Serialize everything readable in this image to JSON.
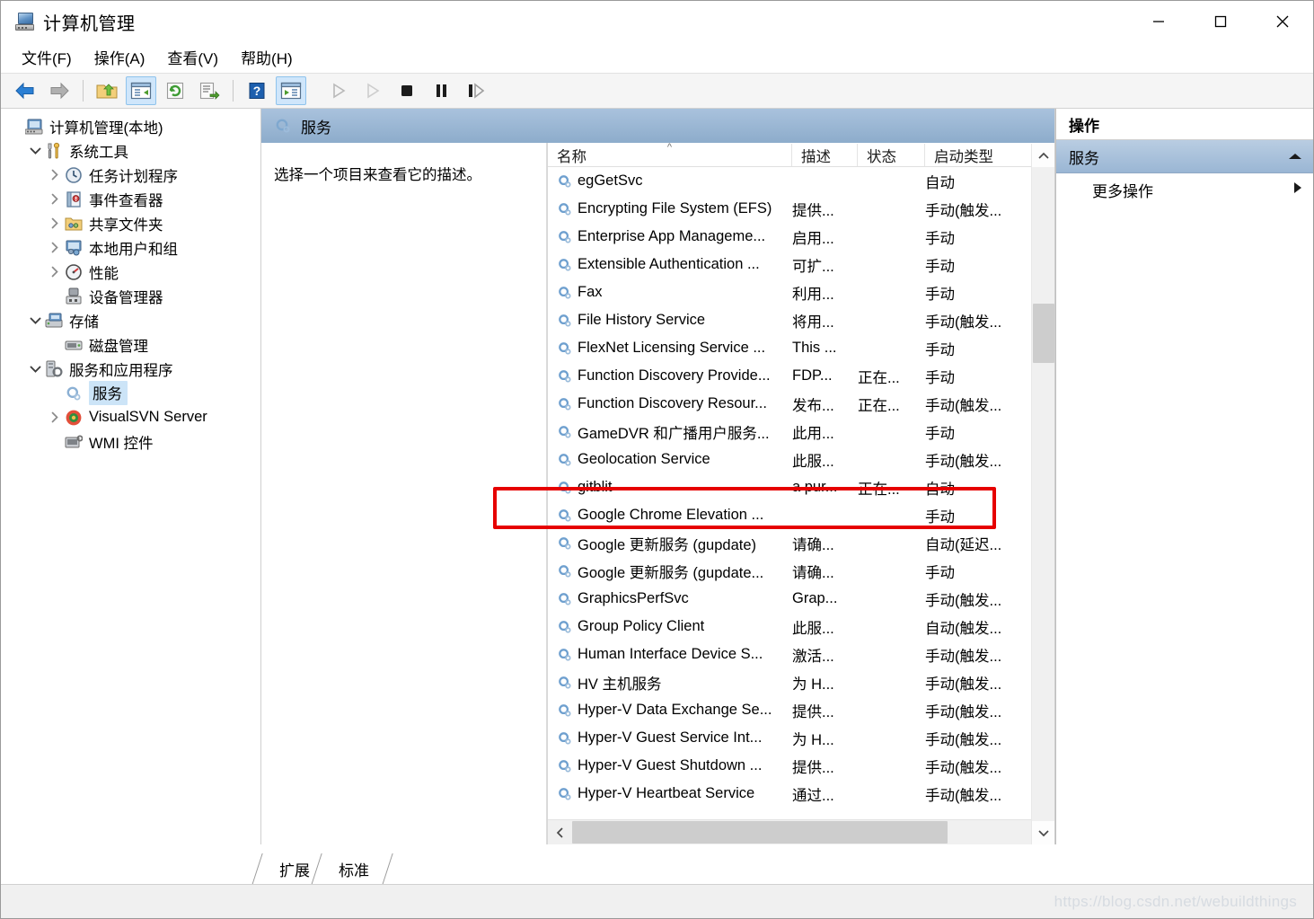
{
  "window": {
    "title": "计算机管理",
    "icon": "computer-management-icon",
    "controls": {
      "minimize": "最小化",
      "maximize": "最大化",
      "close": "关闭"
    }
  },
  "menubar": {
    "items": [
      {
        "name": "file",
        "label": "文件(F)"
      },
      {
        "name": "action",
        "label": "操作(A)"
      },
      {
        "name": "view",
        "label": "查看(V)"
      },
      {
        "name": "help",
        "label": "帮助(H)"
      }
    ]
  },
  "toolbar": {
    "buttons": [
      {
        "name": "back-button",
        "icon": "back-arrow-icon",
        "state": "enabled"
      },
      {
        "name": "forward-button",
        "icon": "forward-arrow-icon",
        "state": "disabled"
      },
      {
        "name": "up-one-level-button",
        "icon": "folder-up-icon",
        "state": "enabled"
      },
      {
        "name": "show-hide-tree-button",
        "icon": "console-tree-icon",
        "state": "active"
      },
      {
        "name": "refresh-button",
        "icon": "refresh-icon",
        "state": "enabled"
      },
      {
        "name": "export-list-button",
        "icon": "export-list-icon",
        "state": "enabled"
      },
      {
        "name": "help-button",
        "icon": "help-question-icon",
        "state": "enabled"
      },
      {
        "name": "show-action-pane-button",
        "icon": "action-pane-icon",
        "state": "active"
      },
      {
        "name": "start-service-button",
        "icon": "play-icon",
        "state": "disabled"
      },
      {
        "name": "restart-service-button",
        "icon": "play-outline-icon",
        "state": "disabled"
      },
      {
        "name": "stop-service-button",
        "icon": "stop-square-icon",
        "state": "enabled"
      },
      {
        "name": "pause-service-button",
        "icon": "pause-icon",
        "state": "enabled"
      },
      {
        "name": "resume-service-button",
        "icon": "resume-icon",
        "state": "enabled"
      }
    ]
  },
  "tree": {
    "nodes": [
      {
        "label": "计算机管理(本地)",
        "indent": 0,
        "twisty": "none",
        "icon": "computer-icon",
        "selected": false
      },
      {
        "label": "系统工具",
        "indent": 1,
        "twisty": "down",
        "icon": "system-tools-icon",
        "selected": false
      },
      {
        "label": "任务计划程序",
        "indent": 2,
        "twisty": "right",
        "icon": "task-scheduler-icon",
        "selected": false
      },
      {
        "label": "事件查看器",
        "indent": 2,
        "twisty": "right",
        "icon": "event-viewer-icon",
        "selected": false
      },
      {
        "label": "共享文件夹",
        "indent": 2,
        "twisty": "right",
        "icon": "shared-folders-icon",
        "selected": false
      },
      {
        "label": "本地用户和组",
        "indent": 2,
        "twisty": "right",
        "icon": "local-users-icon",
        "selected": false
      },
      {
        "label": "性能",
        "indent": 2,
        "twisty": "right",
        "icon": "performance-icon",
        "selected": false
      },
      {
        "label": "设备管理器",
        "indent": 2,
        "twisty": "none",
        "icon": "device-manager-icon",
        "selected": false
      },
      {
        "label": "存储",
        "indent": 1,
        "twisty": "down",
        "icon": "storage-icon",
        "selected": false
      },
      {
        "label": "磁盘管理",
        "indent": 2,
        "twisty": "none",
        "icon": "disk-management-icon",
        "selected": false
      },
      {
        "label": "服务和应用程序",
        "indent": 1,
        "twisty": "down",
        "icon": "services-apps-icon",
        "selected": false
      },
      {
        "label": "服务",
        "indent": 2,
        "twisty": "none",
        "icon": "service-gear-icon",
        "selected": true
      },
      {
        "label": "VisualSVN Server",
        "indent": 2,
        "twisty": "right",
        "icon": "visualsvn-icon",
        "selected": false
      },
      {
        "label": "WMI 控件",
        "indent": 2,
        "twisty": "none",
        "icon": "wmi-control-icon",
        "selected": false
      }
    ]
  },
  "content": {
    "header_title": "服务",
    "header_icon": "service-gear-icon",
    "description_placeholder": "选择一个项目来查看它的描述。",
    "columns": [
      {
        "key": "name",
        "label": "名称",
        "sort": "asc"
      },
      {
        "key": "desc",
        "label": "描述",
        "sort": "none"
      },
      {
        "key": "state",
        "label": "状态",
        "sort": "none"
      },
      {
        "key": "start",
        "label": "启动类型",
        "sort": "none"
      }
    ],
    "rows": [
      {
        "name": "egGetSvc",
        "desc": "",
        "state": "",
        "start": "自动"
      },
      {
        "name": "Encrypting File System (EFS)",
        "desc": "提供...",
        "state": "",
        "start": "手动(触发..."
      },
      {
        "name": "Enterprise App Manageme...",
        "desc": "启用...",
        "state": "",
        "start": "手动"
      },
      {
        "name": "Extensible Authentication ...",
        "desc": "可扩...",
        "state": "",
        "start": "手动"
      },
      {
        "name": "Fax",
        "desc": "利用...",
        "state": "",
        "start": "手动"
      },
      {
        "name": "File History Service",
        "desc": "将用...",
        "state": "",
        "start": "手动(触发..."
      },
      {
        "name": "FlexNet Licensing Service ...",
        "desc": "This ...",
        "state": "",
        "start": "手动"
      },
      {
        "name": "Function Discovery Provide...",
        "desc": "FDP...",
        "state": "正在...",
        "start": "手动"
      },
      {
        "name": "Function Discovery Resour...",
        "desc": "发布...",
        "state": "正在...",
        "start": "手动(触发..."
      },
      {
        "name": "GameDVR 和广播用户服务...",
        "desc": "此用...",
        "state": "",
        "start": "手动"
      },
      {
        "name": "Geolocation Service",
        "desc": "此服...",
        "state": "",
        "start": "手动(触发..."
      },
      {
        "name": "gitblit",
        "desc": "a pur...",
        "state": "正在...",
        "start": "自动"
      },
      {
        "name": "Google Chrome Elevation ...",
        "desc": "",
        "state": "",
        "start": "手动"
      },
      {
        "name": "Google 更新服务 (gupdate)",
        "desc": "请确...",
        "state": "",
        "start": "自动(延迟..."
      },
      {
        "name": "Google 更新服务 (gupdate...",
        "desc": "请确...",
        "state": "",
        "start": "手动"
      },
      {
        "name": "GraphicsPerfSvc",
        "desc": "Grap...",
        "state": "",
        "start": "手动(触发..."
      },
      {
        "name": "Group Policy Client",
        "desc": "此服...",
        "state": "",
        "start": "自动(触发..."
      },
      {
        "name": "Human Interface Device S...",
        "desc": "激活...",
        "state": "",
        "start": "手动(触发..."
      },
      {
        "name": "HV 主机服务",
        "desc": "为 H...",
        "state": "",
        "start": "手动(触发..."
      },
      {
        "name": "Hyper-V Data Exchange Se...",
        "desc": "提供...",
        "state": "",
        "start": "手动(触发..."
      },
      {
        "name": "Hyper-V Guest Service Int...",
        "desc": "为 H...",
        "state": "",
        "start": "手动(触发..."
      },
      {
        "name": "Hyper-V Guest Shutdown ...",
        "desc": "提供...",
        "state": "",
        "start": "手动(触发..."
      },
      {
        "name": "Hyper-V Heartbeat Service",
        "desc": "通过...",
        "state": "",
        "start": "手动(触发..."
      }
    ],
    "highlighted_row": "gitblit",
    "annotation_color": "#e60000"
  },
  "actions": {
    "title": "操作",
    "group_label": "服务",
    "group_collapse_icon": "chevron-up-icon",
    "items": [
      {
        "label": "更多操作",
        "icon": "submenu-arrow-icon"
      }
    ]
  },
  "tabs": [
    {
      "label": "扩展",
      "active": false
    },
    {
      "label": "标准",
      "active": true
    }
  ],
  "statusbar": {
    "watermark": "https://blog.csdn.net/webuildthings"
  }
}
